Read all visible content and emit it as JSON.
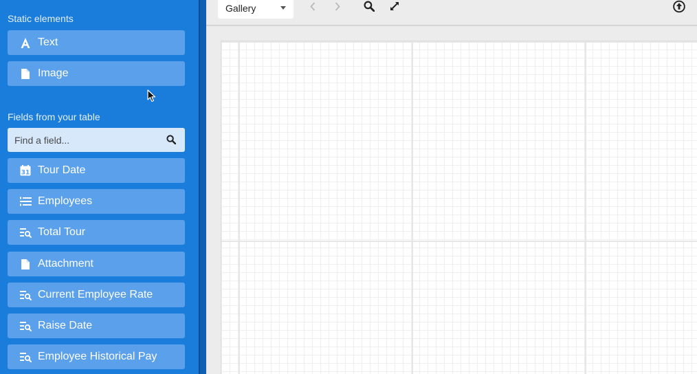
{
  "sidebar": {
    "static_heading": "Static elements",
    "static_items": [
      {
        "label": "Text",
        "icon": "text-a-icon"
      },
      {
        "label": "Image",
        "icon": "file-icon"
      }
    ],
    "fields_heading": "Fields from your table",
    "search": {
      "placeholder": "Find a field...",
      "icon": "search-icon"
    },
    "field_items": [
      {
        "label": "Tour Date",
        "icon": "calendar-icon"
      },
      {
        "label": "Employees",
        "icon": "linked-list-icon"
      },
      {
        "label": "Total Tour",
        "icon": "lookup-icon"
      },
      {
        "label": "Attachment",
        "icon": "file-icon"
      },
      {
        "label": "Current Employee Rate",
        "icon": "lookup-icon"
      },
      {
        "label": "Raise Date",
        "icon": "lookup-icon"
      },
      {
        "label": "Employee Historical Pay",
        "icon": "lookup-icon"
      }
    ]
  },
  "toolbar": {
    "view_selected": "Gallery",
    "icons": [
      "chevron-left-icon",
      "chevron-right-icon",
      "search-icon",
      "expand-icon",
      "upload-icon"
    ]
  },
  "colors": {
    "sidebar_bg": "#1b7ddb",
    "item_bg": "#5aa0ea",
    "search_bg": "#d7e8fb",
    "toolbar_bg": "#ececec"
  }
}
